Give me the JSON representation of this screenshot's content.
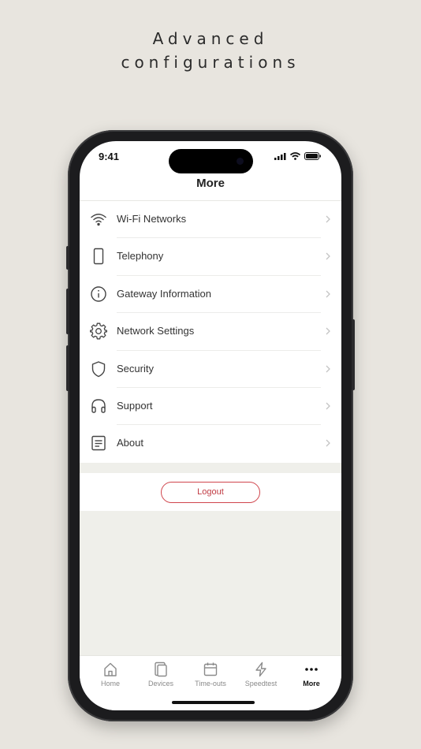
{
  "headline": {
    "line1": "Advanced",
    "line2": "configurations"
  },
  "status": {
    "time": "9:41"
  },
  "nav": {
    "title": "More"
  },
  "menu": [
    {
      "label": "Wi-Fi Networks",
      "icon": "wifi-icon"
    },
    {
      "label": "Telephony",
      "icon": "phone-device-icon"
    },
    {
      "label": "Gateway Information",
      "icon": "info-icon"
    },
    {
      "label": "Network Settings",
      "icon": "gear-icon"
    },
    {
      "label": "Security",
      "icon": "shield-icon"
    },
    {
      "label": "Support",
      "icon": "headset-icon"
    },
    {
      "label": "About",
      "icon": "document-icon"
    }
  ],
  "logout": {
    "label": "Logout"
  },
  "tabs": [
    {
      "label": "Home",
      "icon": "home-icon"
    },
    {
      "label": "Devices",
      "icon": "devices-icon"
    },
    {
      "label": "Time-outs",
      "icon": "calendar-icon"
    },
    {
      "label": "Speedtest",
      "icon": "lightning-icon"
    },
    {
      "label": "More",
      "icon": "more-dots-icon",
      "active": true
    }
  ],
  "colors": {
    "background": "#e8e5df",
    "accent": "#d0454c",
    "list_bg": "#efefea"
  }
}
